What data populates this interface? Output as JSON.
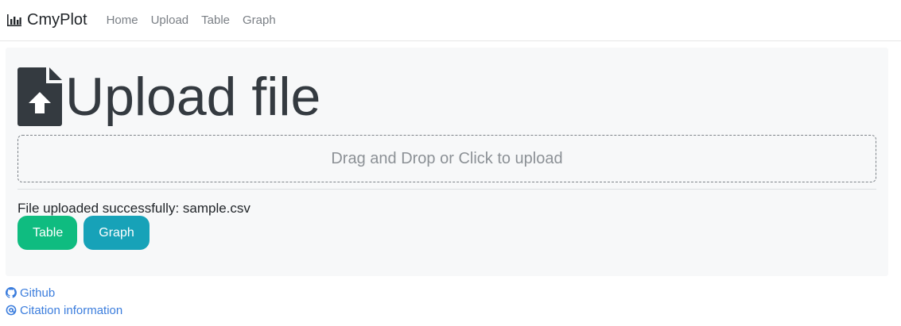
{
  "navbar": {
    "brand": "CmyPlot",
    "brand_icon": "bar-chart-icon",
    "links": [
      "Home",
      "Upload",
      "Table",
      "Graph"
    ]
  },
  "main": {
    "title": "Upload file",
    "title_icon": "file-upload-icon",
    "dropzone_text": "Drag and Drop or Click to upload",
    "status_text": "File uploaded successfully: sample.csv",
    "buttons": {
      "table_label": "Table",
      "graph_label": "Graph"
    }
  },
  "footer": {
    "github_label": "Github",
    "github_icon": "github-icon",
    "citation_label": "Citation information",
    "citation_icon": "at-icon"
  },
  "colors": {
    "table_button": "#0fbc80",
    "graph_button": "#17a2b8",
    "link": "#3b7ddd"
  }
}
